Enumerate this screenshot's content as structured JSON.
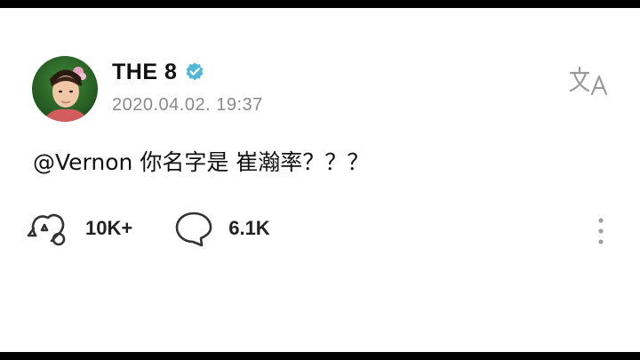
{
  "post": {
    "author": "THE 8",
    "verified_icon": "verified-badge-icon",
    "timestamp": "2020.04.02. 19:37",
    "text": "@Vernon 你名字是 崔瀚率？？？",
    "reaction_count": "10K+",
    "comment_count": "6.1K"
  },
  "icons": {
    "translate": "translate-icon",
    "reaction": "reaction-icon",
    "comment": "comment-icon",
    "more": "more-options-icon"
  },
  "colors": {
    "verified": "#4fb7d8",
    "text": "#111111",
    "timestamp": "#8a8a8a",
    "icon": "#333333"
  }
}
